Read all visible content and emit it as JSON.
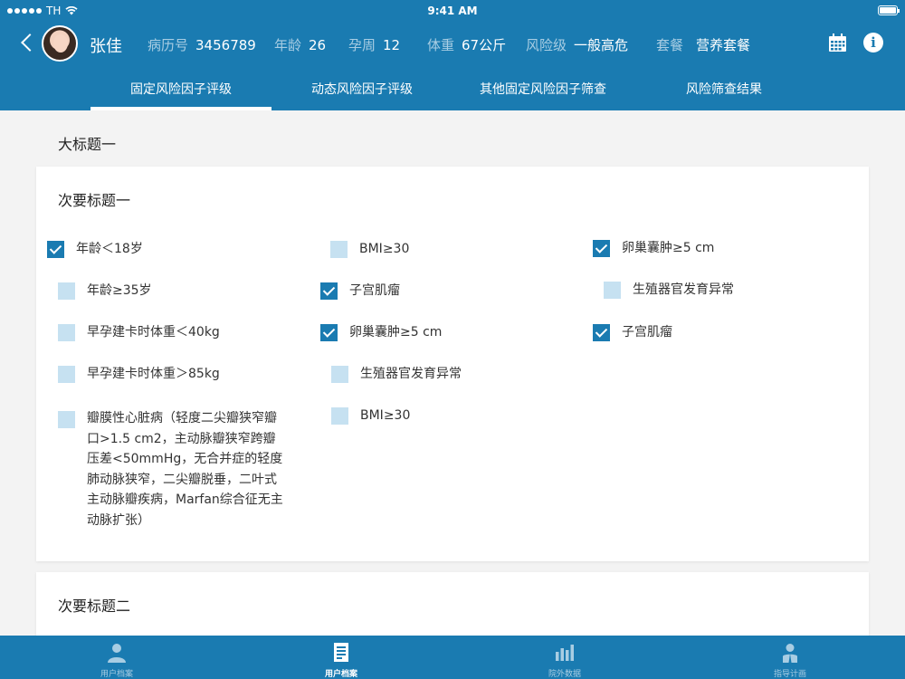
{
  "status_bar": {
    "carrier": "TH",
    "time": "9:41 AM"
  },
  "patient": {
    "name": "张佳",
    "fields": [
      {
        "label": "病历号",
        "value": "3456789"
      },
      {
        "label": "年龄",
        "value": "26"
      },
      {
        "label": "孕周",
        "value": "12"
      },
      {
        "label": "体重",
        "value": "67公斤"
      },
      {
        "label": "风险级",
        "value": "一般高危"
      },
      {
        "label": "套餐",
        "value": "营养套餐"
      }
    ]
  },
  "tabs": [
    {
      "label": "固定风险因子评级",
      "active": true
    },
    {
      "label": "动态风险因子评级",
      "active": false
    },
    {
      "label": "其他固定风险因子筛查",
      "active": false
    },
    {
      "label": "风险筛查结果",
      "active": false
    }
  ],
  "main": {
    "section_title": "大标题一",
    "card1": {
      "title": "次要标题一",
      "options": [
        {
          "label": "年龄＜18岁",
          "checked": true
        },
        {
          "label": "BMI≥30",
          "checked": false
        },
        {
          "label": "卵巢囊肿≥5 cm",
          "checked": true
        },
        {
          "label": "年龄≥35岁",
          "checked": false
        },
        {
          "label": "子宫肌瘤",
          "checked": true
        },
        {
          "label": "生殖器官发育异常",
          "checked": false
        },
        {
          "label": "早孕建卡时体重＜40kg",
          "checked": false
        },
        {
          "label": "卵巢囊肿≥5 cm",
          "checked": true
        },
        {
          "label": "子宫肌瘤",
          "checked": true
        },
        {
          "label": "早孕建卡时体重＞85kg",
          "checked": false
        },
        {
          "label": "生殖器官发育异常",
          "checked": false
        },
        {
          "label": "瓣膜性心脏病（轻度二尖瓣狭窄瓣口>1.5 cm2，主动脉瓣狭窄跨瓣压差<50mmHg，无合并症的轻度肺动脉狭窄，二尖瓣脱垂，二叶式主动脉瓣疾病，Marfan综合征无主动脉扩张）",
          "checked": false
        },
        {
          "label": "BMI≥30",
          "checked": false
        }
      ]
    },
    "card2": {
      "title": "次要标题二"
    }
  },
  "bottom_tabs": [
    {
      "label": "用户档案",
      "icon": "person-icon",
      "active": false
    },
    {
      "label": "用户档案",
      "icon": "document-icon",
      "active": true
    },
    {
      "label": "院外数据",
      "icon": "bar-chart-icon",
      "active": false
    },
    {
      "label": "指导计画",
      "icon": "doctor-icon",
      "active": false
    }
  ],
  "colors": {
    "primary": "#1a7bb1",
    "unchecked": "#c6e1f1",
    "label_muted": "#a8cde3",
    "background": "#f3f3f3"
  }
}
